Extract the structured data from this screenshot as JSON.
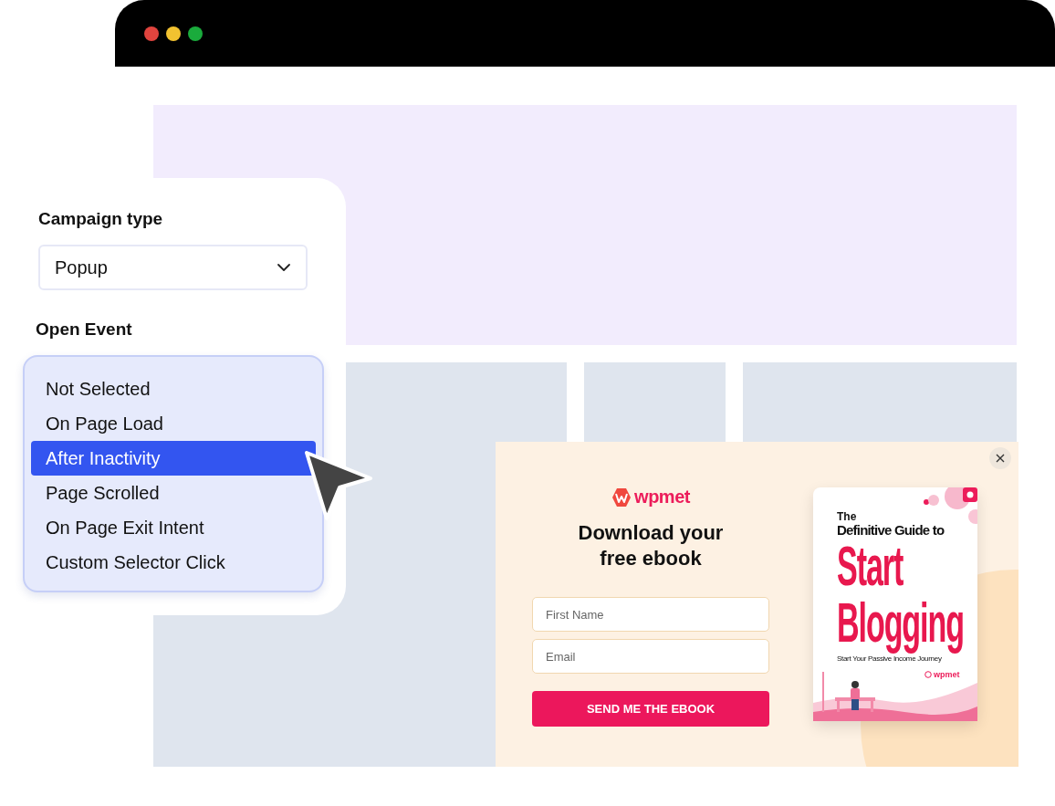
{
  "browser": {
    "controls": [
      {
        "color": "#e0443e"
      },
      {
        "color": "#f2c230"
      },
      {
        "color": "#1aab3c"
      }
    ]
  },
  "campaign_type": {
    "label": "Campaign type",
    "value": "Popup"
  },
  "open_event": {
    "label": "Open Event",
    "options": [
      {
        "label": "Not Selected",
        "selected": false
      },
      {
        "label": "On Page Load",
        "selected": false
      },
      {
        "label": "After Inactivity",
        "selected": true
      },
      {
        "label": "Page Scrolled",
        "selected": false
      },
      {
        "label": "On Page Exit Intent",
        "selected": false
      },
      {
        "label": "Custom Selector Click",
        "selected": false
      }
    ]
  },
  "popup": {
    "logo": "wpmet",
    "heading": "Download your free ebook",
    "fields": [
      {
        "placeholder": "First Name"
      },
      {
        "placeholder": "Email"
      }
    ],
    "button": "SEND ME THE EBOOK",
    "cover": {
      "kicker": "The",
      "title": "Definitive Guide to",
      "big": [
        "Start",
        "Blogging"
      ],
      "subtitle": "Start Your Passive Income Journey",
      "brand": "wpmet"
    }
  }
}
